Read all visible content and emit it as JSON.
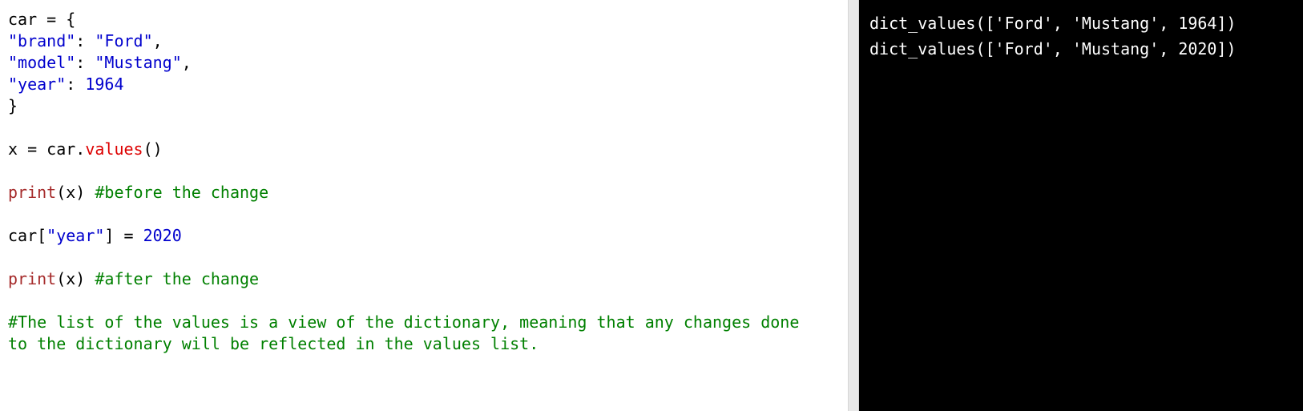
{
  "colors": {
    "editor_background": "#ffffff",
    "output_background": "#000000",
    "string": "#0000cd",
    "number": "#0000cd",
    "method": "#dd0000",
    "function": "#a52a2a",
    "comment": "#008000",
    "output_text": "#ffffff"
  },
  "code": {
    "l1": {
      "a": "car = {"
    },
    "l2": {
      "key": "\"brand\"",
      "sep": ": ",
      "val": "\"Ford\"",
      "end": ","
    },
    "l3": {
      "key": "\"model\"",
      "sep": ": ",
      "val": "\"Mustang\"",
      "end": ","
    },
    "l4": {
      "key": "\"year\"",
      "sep": ": ",
      "val": "1964"
    },
    "l5": {
      "a": "}"
    },
    "l7": {
      "a": "x = car.",
      "method": "values",
      "b": "()"
    },
    "l9": {
      "func": "print",
      "a": "(x) ",
      "comment": "#before the change"
    },
    "l11": {
      "a": "car[",
      "str": "\"year\"",
      "b": "] = ",
      "num": "2020"
    },
    "l13": {
      "func": "print",
      "a": "(x) ",
      "comment": "#after the change"
    },
    "l15": {
      "comment": "#The list of the values is a view of the dictionary, meaning that any changes done"
    },
    "l16": {
      "comment": "to the dictionary will be reflected in the values list."
    }
  },
  "output": {
    "lines": [
      "dict_values(['Ford', 'Mustang', 1964])",
      "dict_values(['Ford', 'Mustang', 2020])"
    ]
  }
}
